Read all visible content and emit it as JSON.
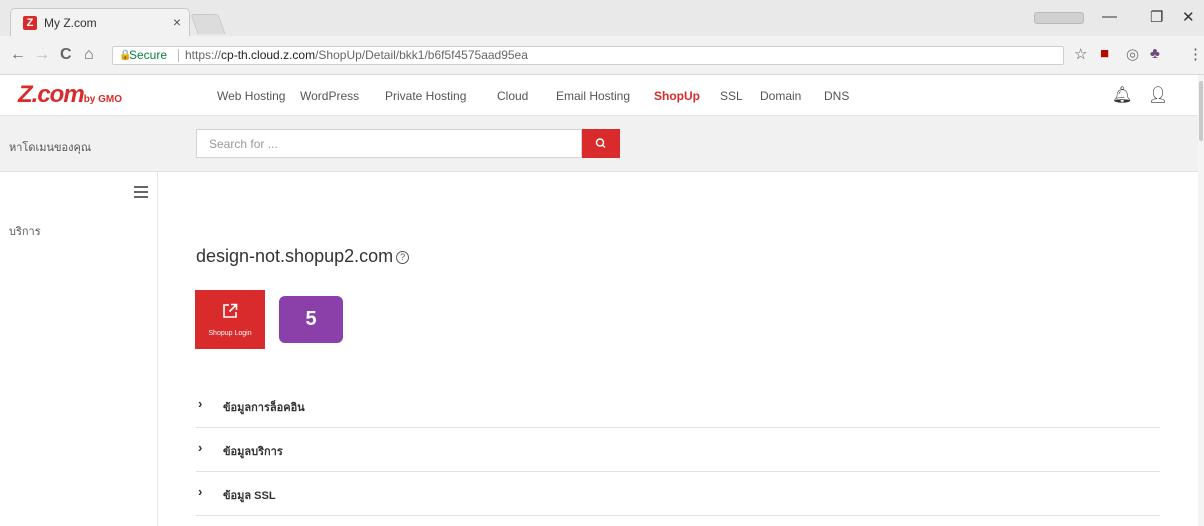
{
  "browser": {
    "tab_title": "My Z.com",
    "tab_close": "×",
    "favicon_letter": "Z",
    "profile_label": "Profile",
    "window": {
      "minimize": "—",
      "restore": "❐",
      "close": "✕"
    },
    "nav": {
      "back": "←",
      "forward": "→",
      "reload": "C",
      "home": "⌂"
    },
    "secure_label": "Secure",
    "url_scheme": "https://",
    "url_host": "cp-th.cloud.z.com",
    "url_path": "/ShopUp/Detail/bkk1/b6f5f4575aad95ea",
    "extensions": [
      "star-icon",
      "pdf-icon",
      "camera-icon",
      "extension-icon",
      "menu-icon"
    ]
  },
  "header": {
    "logo_main": "Z.com",
    "logo_sub": "by GMO",
    "nav_items": [
      {
        "label": "Web Hosting",
        "active": false
      },
      {
        "label": "WordPress",
        "active": false
      },
      {
        "label": "Private Hosting",
        "active": false
      },
      {
        "label": "Cloud",
        "active": false
      },
      {
        "label": "Email Hosting",
        "active": false
      },
      {
        "label": "ShopUp",
        "active": true
      },
      {
        "label": "SSL",
        "active": false
      },
      {
        "label": "Domain",
        "active": false
      },
      {
        "label": "DNS",
        "active": false
      }
    ],
    "icons": [
      "bell-icon",
      "user-icon"
    ]
  },
  "search": {
    "strip_label": "หาโดเมนของคุณ",
    "placeholder": "Search for ...",
    "button_icon": "search-icon"
  },
  "sidebar": {
    "items": [
      {
        "label": "บริการ"
      }
    ]
  },
  "main": {
    "domain": "design-not.shopup2.com",
    "help_glyph": "?",
    "login_button_label": "Shopup Login",
    "badge_value": "5",
    "sections": [
      {
        "label": "ข้อมูลการล็อคอิน"
      },
      {
        "label": "ข้อมูลบริการ"
      },
      {
        "label": "ข้อมูล SSL"
      }
    ]
  },
  "colors": {
    "brand_red": "#d92b2b",
    "badge_purple": "#8b3fa8",
    "secure_green": "#0b8043"
  }
}
